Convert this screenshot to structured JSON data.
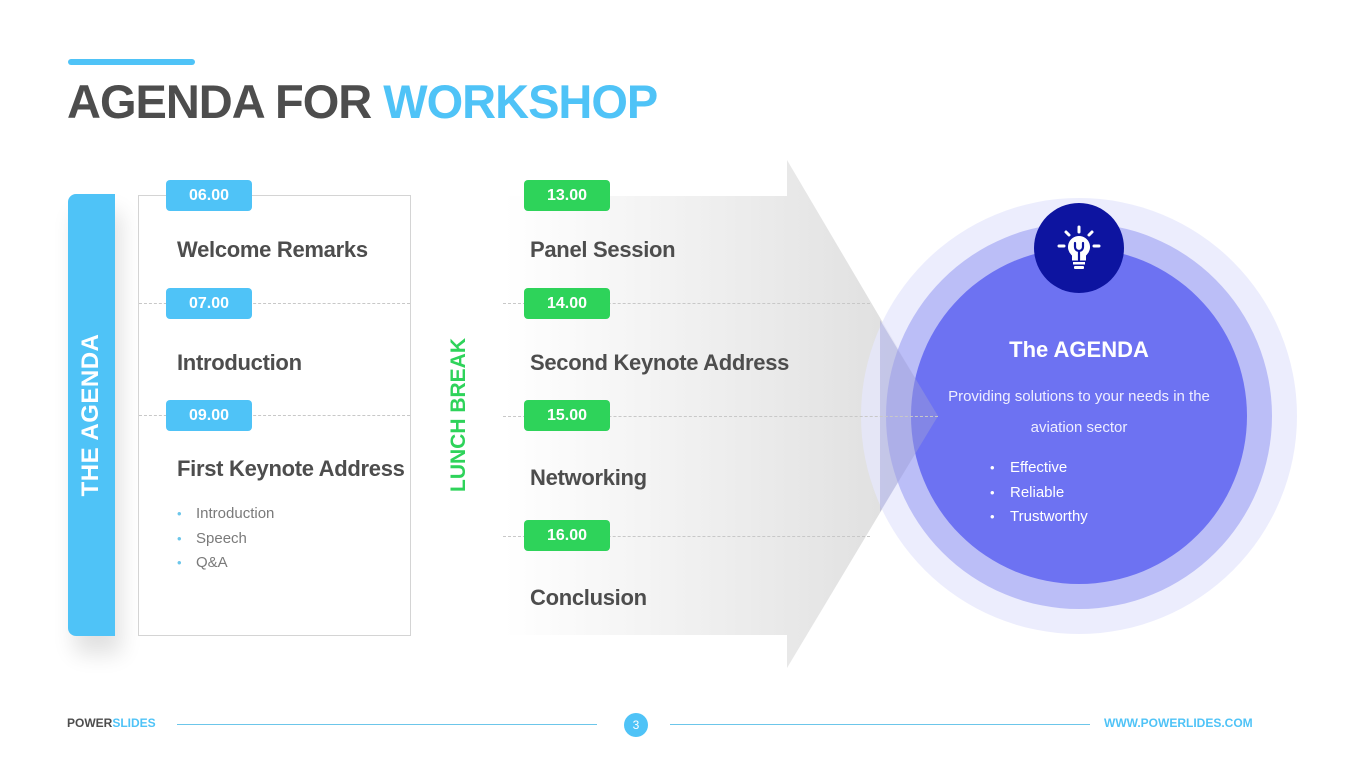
{
  "header": {
    "title_part1": "AGENDA FOR",
    "title_part2": "WORKSHOP"
  },
  "sidebar": {
    "label": "THE AGENDA"
  },
  "morning": {
    "items": [
      {
        "time": "06.00",
        "title": "Welcome Remarks"
      },
      {
        "time": "07.00",
        "title": "Introduction"
      },
      {
        "time": "09.00",
        "title": "First Keynote Address",
        "subitems": [
          "Introduction",
          "Speech",
          "Q&A"
        ]
      }
    ]
  },
  "break_label": "LUNCH BREAK",
  "afternoon": {
    "items": [
      {
        "time": "13.00",
        "title": "Panel Session"
      },
      {
        "time": "14.00",
        "title": "Second Keynote Address"
      },
      {
        "time": "15.00",
        "title": "Networking"
      },
      {
        "time": "16.00",
        "title": "Conclusion"
      }
    ]
  },
  "summary": {
    "icon": "lightbulb-icon",
    "title": "The AGENDA",
    "description": "Providing solutions to your needs in the aviation sector",
    "points": [
      "Effective",
      "Reliable",
      "Trustworthy"
    ]
  },
  "footer": {
    "brand_part1": "POWER",
    "brand_part2": "SLIDES",
    "page_number": "3",
    "url": "WWW.POWERLIDES.COM"
  },
  "colors": {
    "accent_blue": "#4fc3f7",
    "accent_green": "#2ed35a",
    "circle_inner": "#6d72f2",
    "circle_middle": "#b9bbf7",
    "circle_outer": "#eeeffd",
    "icon_bg": "#0d14a0",
    "text_dark": "#4d4d4d"
  }
}
